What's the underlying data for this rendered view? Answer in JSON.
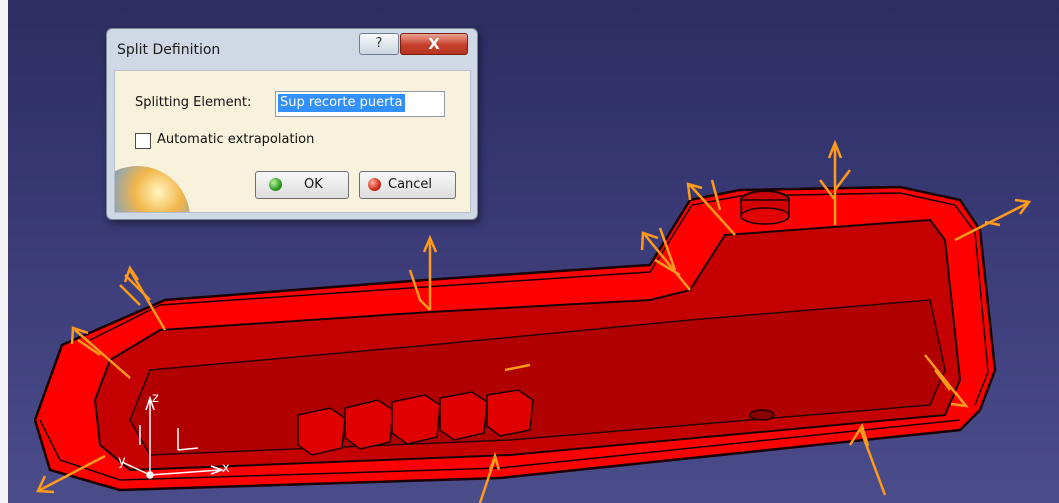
{
  "dialog": {
    "title": "Split Definition",
    "help_glyph": "?",
    "close_glyph": "X",
    "splitting_element_label": "Splitting Element:",
    "splitting_element_value": "Sup recorte puerta",
    "automatic_extrapolation_label": "Automatic extrapolation",
    "automatic_extrapolation_checked": false,
    "ok_label": "OK",
    "cancel_label": "Cancel"
  },
  "axis": {
    "x_label": "x",
    "y_label": "y",
    "z_label": "z"
  },
  "colors": {
    "background": "#393a76",
    "part_red": "#ff0000",
    "part_dark_red": "#b80000",
    "arrow_orange": "#ff9a1a"
  },
  "icons": [
    "help-icon",
    "close-icon",
    "ok-icon",
    "cancel-icon"
  ]
}
